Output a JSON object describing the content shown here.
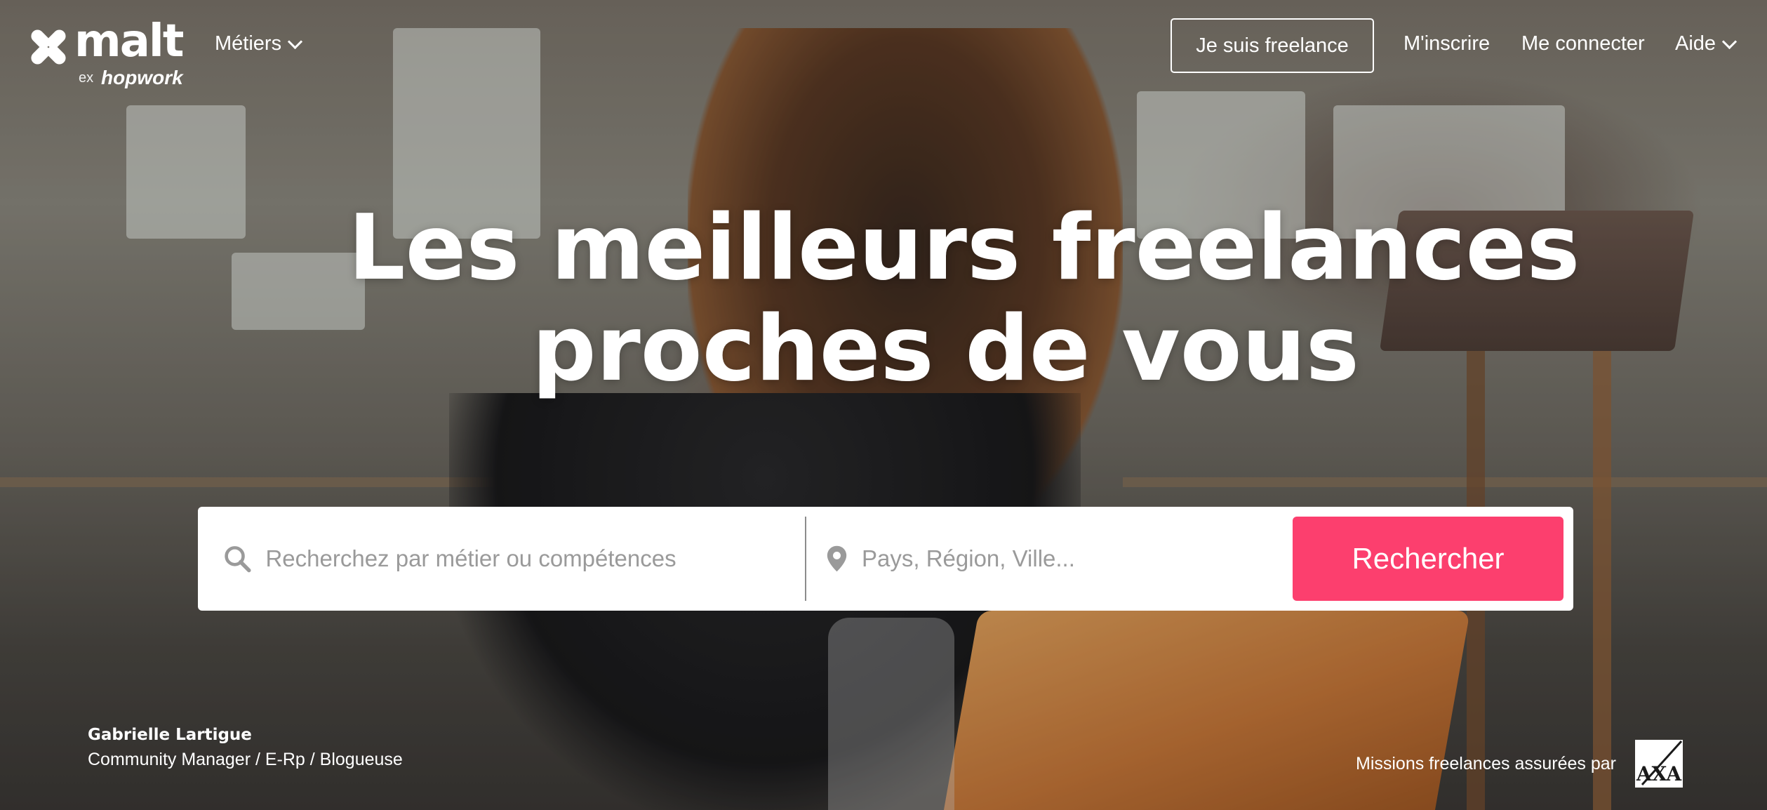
{
  "header": {
    "logo_text": "malt",
    "logo_ex": "ex",
    "logo_sub": "hopwork",
    "nav": {
      "metiers": "Métiers",
      "freelance_button": "Je suis freelance",
      "signup": "M'inscrire",
      "login": "Me connecter",
      "help": "Aide"
    }
  },
  "hero": {
    "title_line1": "Les meilleurs freelances",
    "title_line2": "proches de vous"
  },
  "search": {
    "what_placeholder": "Recherchez par métier ou compétences",
    "where_placeholder": "Pays, Région, Ville...",
    "button_label": "Rechercher"
  },
  "credit": {
    "name": "Gabrielle Lartigue",
    "role": "Community Manager / E-Rp / Blogueuse"
  },
  "footer": {
    "insured_text": "Missions freelances assurées par",
    "insurer_logo_text": "AXA"
  },
  "colors": {
    "accent": "#fc3f6e",
    "search_bg": "#ffffff"
  },
  "icons": {
    "search": "magnifier-icon",
    "location": "map-pin-icon",
    "chevron": "chevron-down-icon"
  }
}
